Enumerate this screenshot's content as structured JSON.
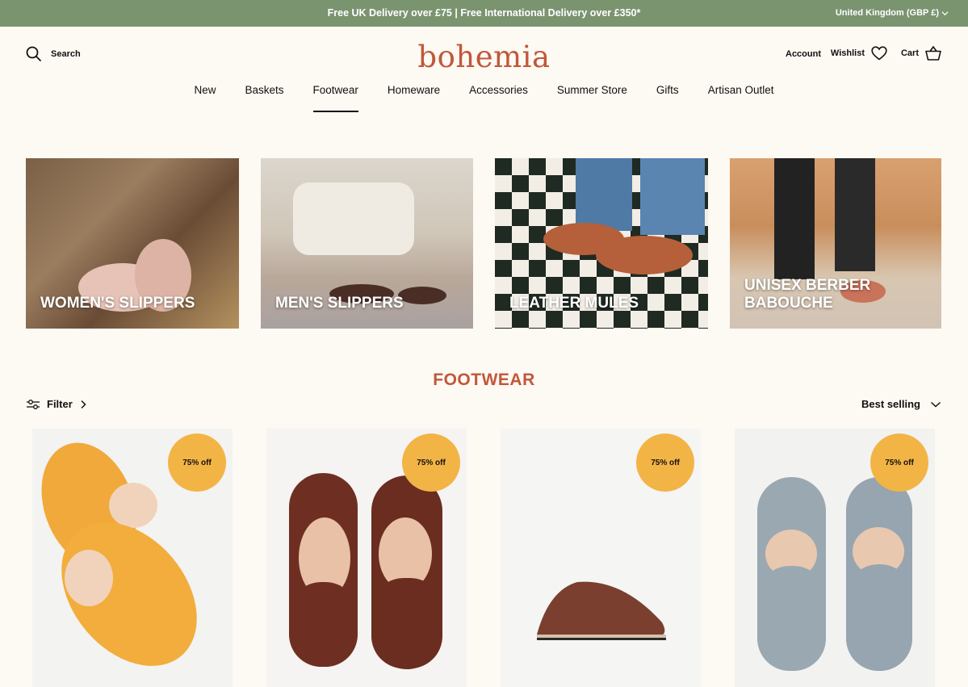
{
  "announcement": {
    "message": "Free UK Delivery over £75 | Free International Delivery over £350*",
    "country": "United Kingdom (GBP £)"
  },
  "header": {
    "search_label": "Search",
    "logo": "bohemia",
    "account_label": "Account",
    "wishlist_label": "Wishlist",
    "cart_label": "Cart"
  },
  "nav": {
    "items": [
      {
        "label": "New"
      },
      {
        "label": "Baskets"
      },
      {
        "label": "Footwear"
      },
      {
        "label": "Homeware"
      },
      {
        "label": "Accessories"
      },
      {
        "label": "Summer Store"
      },
      {
        "label": "Gifts"
      },
      {
        "label": "Artisan Outlet"
      }
    ],
    "active": "Footwear"
  },
  "categories": [
    {
      "label": "WOMEN'S SLIPPERS"
    },
    {
      "label": "MEN'S SLIPPERS"
    },
    {
      "label": "LEATHER MULES"
    },
    {
      "label": "UNISEX BERBER BABOUCHE"
    }
  ],
  "collection": {
    "title": "FOOTWEAR",
    "filter_label": "Filter",
    "sort_label": "Best selling"
  },
  "products": [
    {
      "badge": "75% off",
      "color": "#f0a93a"
    },
    {
      "badge": "75% off",
      "color": "#6e2f22"
    },
    {
      "badge": "75% off",
      "color": "#7a3f2e"
    },
    {
      "badge": "75% off",
      "color": "#9aa8b2"
    }
  ],
  "colors": {
    "announcement_bg": "#7a9470",
    "brand": "#c0583a",
    "badge": "#f3b446",
    "page_bg": "#fdf9f3"
  }
}
